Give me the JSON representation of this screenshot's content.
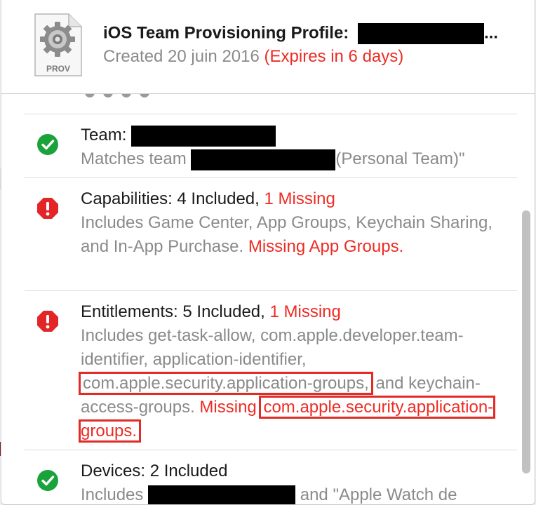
{
  "header": {
    "title": "iOS Team Provisioning Profile:",
    "title_suffix": "...",
    "created": "Created 20 juin 2016",
    "expires": "(Expires in 6 days)",
    "file_type": "PROV"
  },
  "items": [
    {
      "status": "ok",
      "heading": "Team:",
      "desc_prefix": "Matches team",
      "desc_suffix": "(Personal Team)\""
    },
    {
      "status": "error",
      "heading": "Capabilities: 4 Included,",
      "heading_missing": "1 Missing",
      "desc": "Includes Game Center, App Groups, Keychain Sharing, and In-App Purchase.",
      "missing_note": "Missing App Groups."
    },
    {
      "status": "error",
      "heading": "Entitlements: 5 Included,",
      "heading_missing": "1 Missing",
      "desc": "Includes get-task-allow, com.apple.developer.team-identifier, application-identifier,",
      "highlighted": "com.apple.security.application-groups,",
      "desc_tail": "and keychain-access-groups.",
      "missing_label": "Missing",
      "missing_value": "com.apple.security.application-groups."
    },
    {
      "status": "ok",
      "heading": "Devices: 2 Included",
      "desc_prefix": "Includes",
      "desc_suffix": "and \"Apple Watch de"
    }
  ],
  "colors": {
    "ok": "#1aa33b",
    "error": "#e32528",
    "missing_text": "#ee2b24",
    "highlight_box": "#e22a26"
  },
  "icons": {
    "file": "provisioning-profile-file-icon",
    "ok": "checkmark-circle-icon",
    "error": "exclamation-octagon-icon"
  }
}
